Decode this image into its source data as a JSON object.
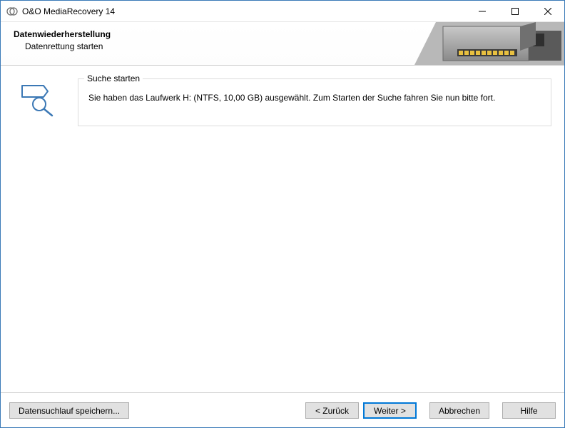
{
  "titlebar": {
    "title": "O&O MediaRecovery 14"
  },
  "header": {
    "title": "Datenwiederherstellung",
    "subtitle": "Datenrettung starten"
  },
  "main": {
    "group_title": "Suche starten",
    "group_text": "Sie haben das Laufwerk H: (NTFS, 10,00 GB) ausgewählt. Zum Starten der Suche fahren Sie nun bitte fort."
  },
  "footer": {
    "save_search": "Datensuchlauf speichern...",
    "back": "< Zurück",
    "next": "Weiter >",
    "cancel": "Abbrechen",
    "help": "Hilfe"
  }
}
